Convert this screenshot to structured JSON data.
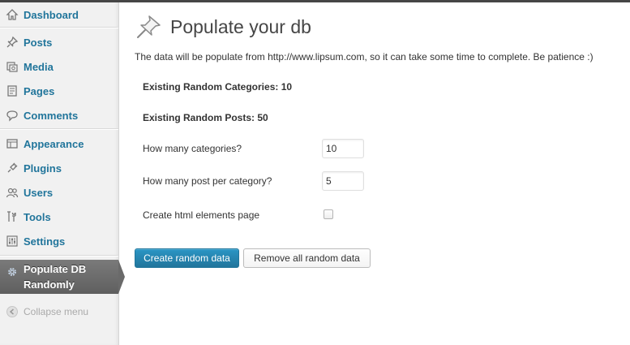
{
  "sidebar": {
    "items": [
      {
        "label": "Dashboard",
        "icon": "dashboard-icon"
      },
      {
        "label": "Posts",
        "icon": "pushpin-icon"
      },
      {
        "label": "Media",
        "icon": "media-icon"
      },
      {
        "label": "Pages",
        "icon": "pages-icon"
      },
      {
        "label": "Comments",
        "icon": "comments-icon"
      },
      {
        "label": "Appearance",
        "icon": "appearance-icon"
      },
      {
        "label": "Plugins",
        "icon": "plugins-icon"
      },
      {
        "label": "Users",
        "icon": "users-icon"
      },
      {
        "label": "Tools",
        "icon": "tools-icon"
      },
      {
        "label": "Settings",
        "icon": "settings-icon"
      }
    ],
    "current": {
      "label_line1": "Populate DB",
      "label_line2": "Randomly",
      "icon": "gear-icon"
    },
    "collapse_label": "Collapse menu"
  },
  "main": {
    "title": "Populate your db",
    "intro": "The data will be populate from http://www.lipsum.com, so it can take some time to complete. Be patience :)",
    "existing_categories": "Existing Random Categories: 10",
    "existing_posts": "Existing Random Posts: 50",
    "fields": {
      "categories_label": "How many categories?",
      "categories_value": "10",
      "posts_label": "How many post per category?",
      "posts_value": "5",
      "html_page_label": "Create html elements page"
    },
    "buttons": {
      "create": "Create random data",
      "remove": "Remove all random data"
    }
  },
  "colors": {
    "link": "#21759b",
    "primary_button": "#21759b",
    "current_menu": "#6a6a6a"
  }
}
